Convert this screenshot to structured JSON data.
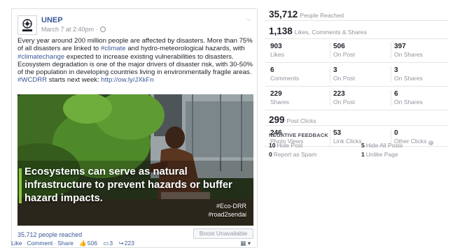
{
  "post": {
    "page_name": "UNEP",
    "timestamp": "March 7 at 2:40pm ·",
    "text_parts": {
      "p1": "Every year around 200 million people are affected by disasters. More than 75% of all disasters are linked to ",
      "tag_climate": "#climate",
      "p2": " and hydro-meteorological hazards, with ",
      "tag_climatechange": "#climatechange",
      "p3": " expected to increase existing vulnerabilities to disasters. Ecosystem degradation is one of the major drivers of disaster risk, with 30-50% of the population in developing countries living in environmentally fragile areas.",
      "tag_wcdrr": "#WCDRR",
      "p4": " starts next week: ",
      "link": "http://ow.ly/JXkFn"
    },
    "image": {
      "headline": "Ecosystems can serve as natural infrastructure to prevent hazards or buffer hazard impacts.",
      "tag1": "#Eco-DRR",
      "tag2": "#road2sendai"
    },
    "reach_text": "35,712 people reached",
    "boost_label": "Boost Unavailable",
    "actions": {
      "like": "Like",
      "comment": "Comment",
      "share": "Share",
      "likes_count": "506",
      "comments_count": "3",
      "shares_count": "223"
    }
  },
  "insights": {
    "people_reached": {
      "value": "35,712",
      "label": "People Reached"
    },
    "engagement": {
      "value": "1,138",
      "label": "Likes, Comments & Shares"
    },
    "likes_row": [
      {
        "value": "903",
        "label": "Likes"
      },
      {
        "value": "506",
        "label": "On Post"
      },
      {
        "value": "397",
        "label": "On Shares"
      }
    ],
    "comments_row": [
      {
        "value": "6",
        "label": "Comments"
      },
      {
        "value": "3",
        "label": "On Post"
      },
      {
        "value": "3",
        "label": "On Shares"
      }
    ],
    "shares_row": [
      {
        "value": "229",
        "label": "Shares"
      },
      {
        "value": "223",
        "label": "On Post"
      },
      {
        "value": "6",
        "label": "On Shares"
      }
    ],
    "post_clicks": {
      "value": "299",
      "label": "Post Clicks"
    },
    "clicks_row": [
      {
        "value": "246",
        "label": "Photo Views"
      },
      {
        "value": "53",
        "label": "Link Clicks"
      },
      {
        "value": "0",
        "label": "Other Clicks"
      }
    ],
    "negative_feedback": {
      "heading": "NEGATIVE FEEDBACK",
      "items": [
        {
          "value": "10",
          "label": "Hide Post"
        },
        {
          "value": "5",
          "label": "Hide All Posts"
        },
        {
          "value": "0",
          "label": "Report as Spam"
        },
        {
          "value": "1",
          "label": "Unlike Page"
        }
      ]
    }
  },
  "colors": {
    "link_blue": "#3b5998",
    "muted": "#90949c",
    "accent_green": "#8cc63f"
  },
  "icons": [
    "un-emblem-icon",
    "globe-icon",
    "chevron-down-icon",
    "thumbs-up-icon",
    "comment-icon",
    "share-icon",
    "info-icon"
  ]
}
